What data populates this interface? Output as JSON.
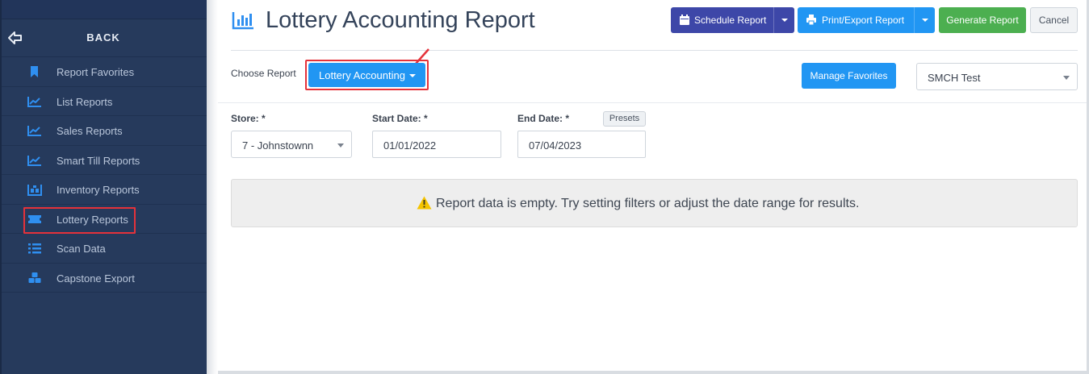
{
  "sidebar": {
    "back_label": "BACK",
    "items": [
      {
        "label": "Report Favorites",
        "icon": "bookmark-icon"
      },
      {
        "label": "List Reports",
        "icon": "line-chart-icon"
      },
      {
        "label": "Sales Reports",
        "icon": "line-chart-icon"
      },
      {
        "label": "Smart Till Reports",
        "icon": "line-chart-icon"
      },
      {
        "label": "Inventory Reports",
        "icon": "inventory-icon"
      },
      {
        "label": "Lottery Reports",
        "icon": "ticket-icon"
      },
      {
        "label": "Scan Data",
        "icon": "list-icon"
      },
      {
        "label": "Capstone Export",
        "icon": "cubes-icon"
      }
    ]
  },
  "header": {
    "title": "Lottery Accounting Report",
    "schedule_label": "Schedule Report",
    "print_label": "Print/Export Report",
    "generate_label": "Generate Report",
    "cancel_label": "Cancel"
  },
  "report_chooser": {
    "label": "Choose Report",
    "selected": "Lottery Accounting",
    "manage_favorites_label": "Manage Favorites",
    "company_selected": "SMCH Test"
  },
  "filters": {
    "store_label": "Store: *",
    "store_value": "7 - Johnstownn",
    "start_label": "Start Date: *",
    "start_value": "01/01/2022",
    "end_label": "End Date: *",
    "end_value": "07/04/2023",
    "presets_label": "Presets"
  },
  "empty_message": "Report data is empty. Try setting filters or adjust the date range for results.",
  "colors": {
    "sidebar_bg": "#263a5c",
    "primary_blue": "#2196f3",
    "schedule_indigo": "#3d47a8",
    "generate_green": "#4caf50",
    "highlight_red": "#e5323a",
    "warning_yellow": "#f5c400"
  }
}
